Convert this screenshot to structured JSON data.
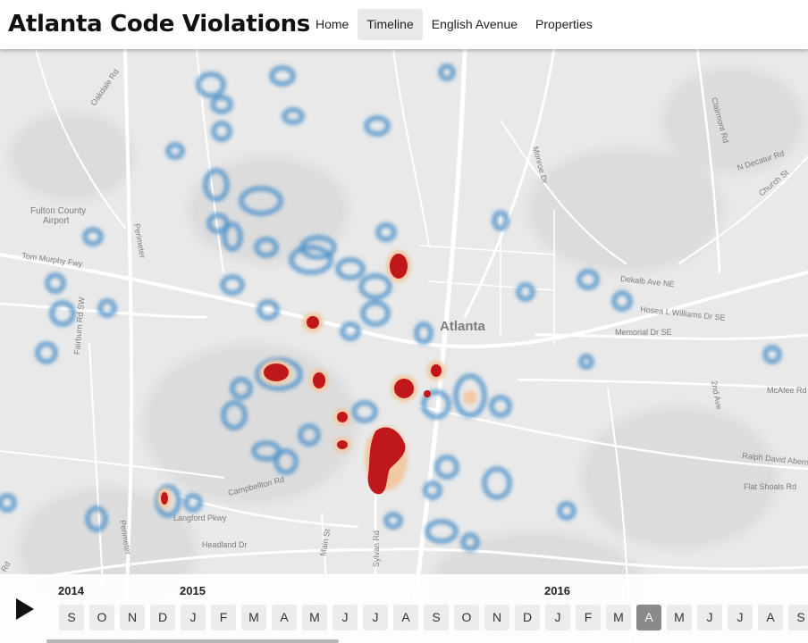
{
  "header": {
    "title": "Atlanta Code Violations",
    "nav": [
      {
        "label": "Home",
        "active": false
      },
      {
        "label": "Timeline",
        "active": true
      },
      {
        "label": "English Avenue",
        "active": false
      },
      {
        "label": "Properties",
        "active": false
      }
    ]
  },
  "map": {
    "city_label": "Atlanta",
    "place_labels": {
      "fulton_county_airport": [
        "Fulton County",
        "Airport"
      ],
      "oakdale_rd": "Oakdale Rd",
      "tom_murphy_fwy": "Tom Murphy Fwy",
      "perimeter_left": "Perimeter",
      "perimeter_bottom": "Perimeter",
      "fairburn_rd_sw": "Fairburn Rd SW",
      "campbellton_rd": "Campbellton Rd",
      "langford_pkwy": "Langford Pkwy",
      "headland_dr": "Headland Dr",
      "main_st": "Main St",
      "sylvan_rd": "Sylvan Rd",
      "monroe_dr": "Monroe Dr",
      "clairmont_rd": "Clairmont Rd",
      "n_decatur_rd": "N Decatur Rd",
      "church_st": "Church St",
      "dekalb_ave_ne": "Dekalb Ave NE",
      "hosea_l_williams_dr_se": "Hosea L Williams Dr SE",
      "memorial_dr_se": "Memorial Dr SE",
      "mcafee_rd": "McAfee Rd",
      "second_ave": "2nd Ave",
      "ralph_david_abernathy": "Ralph David Aberna",
      "flat_shoals_rd": "Flat Shoals Rd",
      "rd_edge": "Rd"
    },
    "colors": {
      "heat_low": "#4a90c8",
      "heat_high": "#c0171b",
      "land": "#e9e9e9",
      "road": "#ffffff"
    }
  },
  "timeline": {
    "years": [
      {
        "label": "2014"
      },
      {
        "label": "2015"
      },
      {
        "label": "2016"
      }
    ],
    "months": [
      "S",
      "O",
      "N",
      "D",
      "J",
      "F",
      "M",
      "A",
      "M",
      "J",
      "J",
      "A",
      "S",
      "O",
      "N",
      "D",
      "J",
      "F",
      "M",
      "A",
      "M",
      "J",
      "J",
      "A",
      "S"
    ],
    "selected_index": 19
  }
}
